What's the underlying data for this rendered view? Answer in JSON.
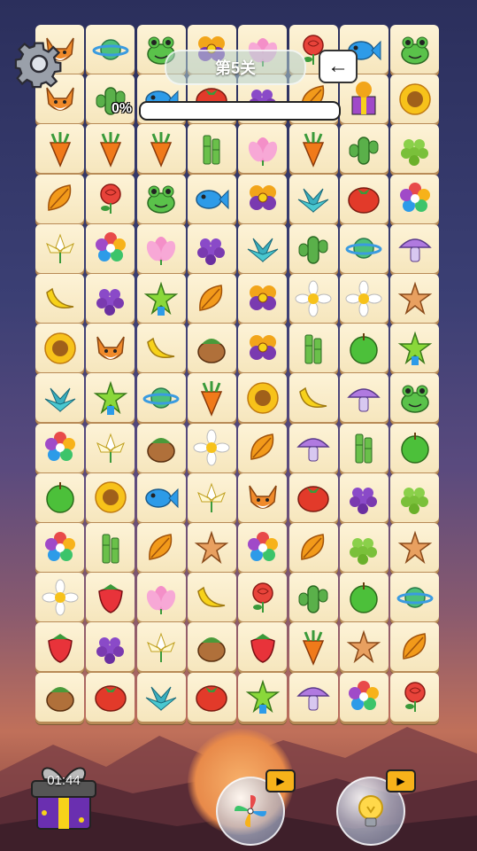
{
  "header": {
    "level_label": "第5关",
    "progress_label": "0%",
    "progress_value": 0
  },
  "footer": {
    "timer": "01:44"
  },
  "colors": {
    "tile": "#fdf3d7",
    "tile_edge": "#b88b57"
  },
  "grid": [
    [
      "fox-icon",
      "planet-icon",
      "frog-icon",
      "pansy-icon",
      "lotus-icon",
      "rose-icon",
      "fish-icon",
      "frog-icon"
    ],
    [
      "fox-icon",
      "cactus-icon",
      "fish-icon",
      "tomato-icon",
      "grapes-icon",
      "leaf-icon",
      "gift-icon",
      "sunflower-icon"
    ],
    [
      "carrot-icon",
      "carrot-icon",
      "carrot-icon",
      "bamboo-icon",
      "lotus-icon",
      "carrot-icon",
      "cactus-icon",
      "grapes-green-icon"
    ],
    [
      "leaf-icon",
      "rose-icon",
      "frog-icon",
      "fish-icon",
      "pansy-icon",
      "succulent-icon",
      "tomato-icon",
      "rainbow-flower-icon"
    ],
    [
      "lily-icon",
      "rainbow-flower-icon",
      "lotus-icon",
      "grapes-icon",
      "succulent-icon",
      "cactus-icon",
      "planet-icon",
      "mushroom-icon"
    ],
    [
      "banana-icon",
      "grapes-icon",
      "star-icon",
      "leaf-icon",
      "pansy-icon",
      "daisy-icon",
      "daisy-icon",
      "starfish-icon"
    ],
    [
      "sunflower-icon",
      "fox-icon",
      "banana-icon",
      "hazelnut-icon",
      "pansy-icon",
      "bamboo-icon",
      "apple-icon",
      "star-icon"
    ],
    [
      "succulent-icon",
      "star-icon",
      "planet-icon",
      "carrot-icon",
      "sunflower-icon",
      "banana-icon",
      "mushroom-icon",
      "frog-icon"
    ],
    [
      "rainbow-flower-icon",
      "lily-icon",
      "hazelnut-icon",
      "daisy-icon",
      "leaf-icon",
      "mushroom-icon",
      "bamboo-icon",
      "apple-icon"
    ],
    [
      "apple-icon",
      "sunflower-icon",
      "fish-icon",
      "lily-icon",
      "fox-icon",
      "tomato-icon",
      "grapes-icon",
      "grapes-green-icon"
    ],
    [
      "rainbow-flower-icon",
      "bamboo-icon",
      "leaf-icon",
      "starfish-icon",
      "rainbow-flower-icon",
      "leaf-icon",
      "grapes-green-icon",
      "starfish-icon"
    ],
    [
      "daisy-icon",
      "strawberry-icon",
      "lotus-icon",
      "banana-icon",
      "rose-icon",
      "cactus-icon",
      "apple-icon",
      "planet-icon"
    ],
    [
      "strawberry-icon",
      "grapes-icon",
      "lily-icon",
      "hazelnut-icon",
      "strawberry-icon",
      "carrot-icon",
      "starfish-icon",
      "leaf-icon"
    ],
    [
      "hazelnut-icon",
      "tomato-icon",
      "succulent-icon",
      "tomato-icon",
      "star-icon",
      "mushroom-icon",
      "rainbow-flower-icon",
      "rose-icon"
    ]
  ]
}
